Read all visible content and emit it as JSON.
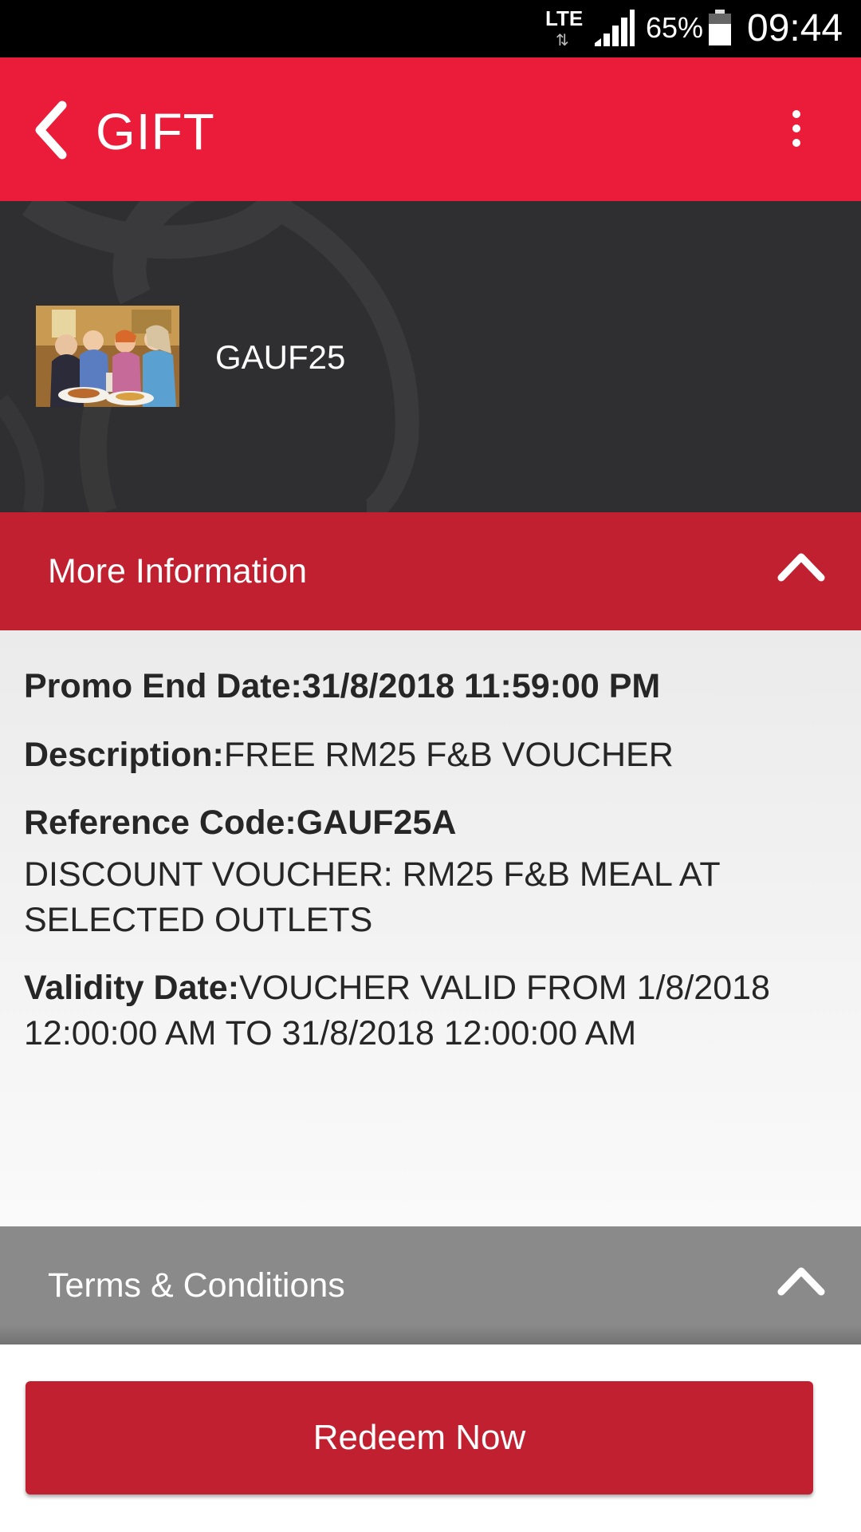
{
  "status_bar": {
    "network": "LTE",
    "battery_percent": "65%",
    "time": "09:44",
    "icons": [
      "lte-arrows-icon",
      "signal-icon",
      "battery-icon"
    ]
  },
  "app_bar": {
    "title": "GIFT",
    "icons": [
      "back-arrow-icon",
      "overflow-menu-icon"
    ]
  },
  "gift": {
    "code": "GAUF25",
    "image": "restaurant-diners-photo"
  },
  "more_info": {
    "header": "More Information",
    "promo_end_label": "Promo End Date:",
    "promo_end_value": "31/8/2018 11:59:00 PM",
    "description_label": "Description:",
    "description_value": "FREE RM25 F&B VOUCHER",
    "reference_label": "Reference Code:",
    "reference_value": "GAUF25A",
    "reference_detail": "DISCOUNT VOUCHER: RM25 F&B MEAL AT SELECTED OUTLETS",
    "validity_label": "Validity Date:",
    "validity_value": "VOUCHER VALID FROM 1/8/2018 12:00:00 AM TO 31/8/2018 12:00:00 AM"
  },
  "terms": {
    "header": "Terms & Conditions"
  },
  "actions": {
    "redeem_label": "Redeem Now"
  },
  "colors": {
    "app_bar": "#eb1c3a",
    "section_header": "#c0202f",
    "terms_header": "#8a8a8a",
    "hero_bg": "#2f2f31",
    "redeem_button": "#c0202f"
  }
}
